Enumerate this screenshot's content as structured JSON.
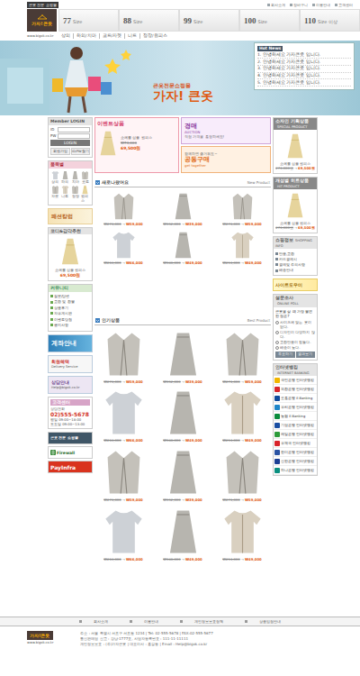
{
  "header": {
    "tagline": "큰옷 전문 쇼핑몰",
    "top_links": [
      "회사소개",
      "장바구니",
      "이용안내",
      "고객센터"
    ],
    "logo": "가자!큰옷",
    "sizes": [
      {
        "num": "77",
        "unit": "Size"
      },
      {
        "num": "88",
        "unit": "Size"
      },
      {
        "num": "99",
        "unit": "Size"
      },
      {
        "num": "100",
        "unit": "Size"
      },
      {
        "num": "110",
        "unit": "Size 이상"
      }
    ],
    "url": "www.bigok.co.kr",
    "nav": [
      "상의",
      "하의/치마",
      "코트/자켓",
      "니트",
      "정장/원피스"
    ]
  },
  "banner": {
    "subtitle": "큰옷전문쇼핑몰",
    "title": "가자! 큰옷",
    "news_title": "Hot News",
    "news": [
      "1. 안녕하세요 가자큰옷 입니다.",
      "2. 안녕하세요 가자큰옷 입니다.",
      "3. 안녕하세요 가자큰옷 입니다.",
      "4. 안녕하세요 가자큰옷 입니다.",
      "5. 안녕하세요 가자큰옷 입니다."
    ]
  },
  "login": {
    "title": "Member LOGIN",
    "fields": [
      "ID",
      "PW"
    ],
    "button": "LOGIN",
    "links": [
      "회원가입",
      "ID/PW찾기"
    ]
  },
  "categories": {
    "title": "품목별",
    "items": [
      {
        "label": "상의",
        "kind": "sweater"
      },
      {
        "label": "하의",
        "kind": "skirt"
      },
      {
        "label": "치마",
        "kind": "skirt"
      },
      {
        "label": "코트",
        "kind": "jacket"
      },
      {
        "label": "자켓",
        "kind": "jacket"
      },
      {
        "label": "니트",
        "kind": "cardigan"
      },
      {
        "label": "정장",
        "kind": "jacket"
      },
      {
        "label": "원피스",
        "kind": "dress"
      }
    ]
  },
  "column_banner": "패션칼럼",
  "coordi": {
    "title": "코디&감각추천",
    "name": "쇼에롤 심플 원피스",
    "price": "69,500원"
  },
  "community": {
    "title": "커뮤니티",
    "items": [
      "질문/답변",
      "교환 및 환불",
      "상품후기",
      "자유게시판",
      "이벤트당첨",
      "공지사항"
    ]
  },
  "account_banner": "계좌안내",
  "delivery_banner": {
    "title": "회원혜택",
    "sub": "Delivery Service"
  },
  "help": {
    "title": "상담안내",
    "email": "Help@bigok.co.kr"
  },
  "call": {
    "title": "고객센터",
    "label": "상담전화",
    "phone": "02)555-5678",
    "hours": [
      "평일 09:00~18:00",
      "토요일 09:00~13:00"
    ]
  },
  "badges": {
    "shop": "큰옷 전문 쇼핑몰",
    "firewall": "Firewall",
    "payinfra": "PayInfra"
  },
  "promo": {
    "event": {
      "title": "이벤트상품",
      "name": "쇼에롤 심플 원피스",
      "old_price": "₩74,000",
      "price": "69,500원"
    },
    "auction": {
      "title": "경매",
      "en": "AUCTION",
      "text": "직접 가격을 흥정하세요!"
    },
    "group": {
      "text": "함께하면 즐거워요~",
      "title": "공동구매",
      "en": "get together"
    }
  },
  "new_products": {
    "title": "새로나왔어요",
    "en": "New Product",
    "arrow": "→",
    "items": [
      {
        "kind": "jacket",
        "old_price": "₩274,000",
        "price": "₩59,000"
      },
      {
        "kind": "skirt",
        "old_price": "₩152,000",
        "price": "₩39,000"
      },
      {
        "kind": "jacket",
        "old_price": "₩274,000",
        "price": "₩59,000"
      },
      {
        "kind": "sweater",
        "old_price": "₩264,000",
        "price": "₩66,000"
      },
      {
        "kind": "skirt",
        "old_price": "₩186,000",
        "price": "₩49,000"
      },
      {
        "kind": "cardigan",
        "old_price": "₩214,000",
        "price": "₩49,000"
      }
    ]
  },
  "best_products": {
    "title": "인기상품",
    "en": "Best Product",
    "arrow": "→",
    "items": [
      {
        "kind": "jacket",
        "old_price": "₩274,000",
        "price": "₩59,000"
      },
      {
        "kind": "skirt",
        "old_price": "₩152,000",
        "price": "₩39,000"
      },
      {
        "kind": "jacket",
        "old_price": "₩274,000",
        "price": "₩59,000"
      },
      {
        "kind": "sweater",
        "old_price": "₩264,000",
        "price": "₩66,000"
      },
      {
        "kind": "skirt",
        "old_price": "₩186,000",
        "price": "₩49,000"
      },
      {
        "kind": "cardigan",
        "old_price": "₩214,000",
        "price": "₩49,000"
      },
      {
        "kind": "jacket",
        "old_price": "₩274,000",
        "price": "₩59,000"
      },
      {
        "kind": "skirt",
        "old_price": "₩152,000",
        "price": "₩39,000"
      },
      {
        "kind": "jacket",
        "old_price": "₩274,000",
        "price": "₩59,000"
      },
      {
        "kind": "sweater",
        "old_price": "₩264,000",
        "price": "₩66,000"
      },
      {
        "kind": "skirt",
        "old_price": "₩186,000",
        "price": "₩49,000"
      },
      {
        "kind": "cardigan",
        "old_price": "₩214,000",
        "price": "₩49,000"
      }
    ]
  },
  "special": {
    "title": "소자인 기획상품",
    "en": "SPECIAL PRODUCT",
    "name": "쇼에롤 심플 원피스",
    "old_price": "274,000원",
    "arrow": "→",
    "price": "69,500원"
  },
  "hit": {
    "title": "개성별 히트상품",
    "en": "HIT PRODUCT",
    "name": "쇼에롤 심플 원피스",
    "old_price": "274,000원",
    "arrow": "→",
    "price": "69,500원"
  },
  "shop_info": {
    "title": "쇼핑정보",
    "en": "SHOPPING INFO",
    "items": [
      "반품,교환",
      "카드결제시",
      "결제및 주의사항",
      "배송안내"
    ]
  },
  "helper_banner": "사이트도우미",
  "poll": {
    "title": "설문조사",
    "en": "ONLINE POLL",
    "question": "큰옷을 살 때 가장 불편한 점은?",
    "options": [
      {
        "label": "사이즈에 맞는 옷이 없다.",
        "selected": false
      },
      {
        "label": "디자인이 다양하지 않다.",
        "selected": false
      },
      {
        "label": "교환반품이 힘들다.",
        "selected": false
      },
      {
        "label": "배송이 늦다.",
        "selected": false
      }
    ],
    "buttons": [
      "투표하기",
      "결과보기"
    ]
  },
  "banking": {
    "title": "인터넷뱅킹",
    "en": "INTERNET BANKING",
    "banks": [
      {
        "label": "국민은행 인터넷뱅킹",
        "color": "#f2b600"
      },
      {
        "label": "외환은행 인터넷뱅킹",
        "color": "#d9262c"
      },
      {
        "label": "조흥은행 E-Banking",
        "color": "#0f4b9c"
      },
      {
        "label": "우리은행 인터넷뱅킹",
        "color": "#1f86c8"
      },
      {
        "label": "농협 E-Banking",
        "color": "#0a8c3c"
      },
      {
        "label": "기업은행 인터넷뱅킹",
        "color": "#1a4ea2"
      },
      {
        "label": "제일은행 인터넷뱅킹",
        "color": "#2c9b3a"
      },
      {
        "label": "우체국 인터넷뱅킹",
        "color": "#d8232a"
      },
      {
        "label": "한미은행 인터넷뱅킹",
        "color": "#2a53a3"
      },
      {
        "label": "신한은행 인터넷뱅킹",
        "color": "#1c3f94"
      },
      {
        "label": "하나은행 인터넷뱅킹",
        "color": "#0a8f7f"
      }
    ]
  },
  "footer": {
    "links": [
      "회사소개",
      "이용안내",
      "개인정보보호정책",
      "상품입점안내"
    ],
    "logo": "가자!큰옷",
    "url": "www.bigok.co.kr",
    "address": [
      "주소 : 서울 특별시 서초구 서초동 1234 | Tel: 02-555-5678 | FAX:02-555-5677",
      "통신판매업 신고 : 강남-1777호, 사업자등록번호 : 111-11-11111",
      "개인정보보호 : (주)가자큰옷 | 대표이사 : 홍길동 | Email : Help@bigok.co.kr"
    ]
  }
}
